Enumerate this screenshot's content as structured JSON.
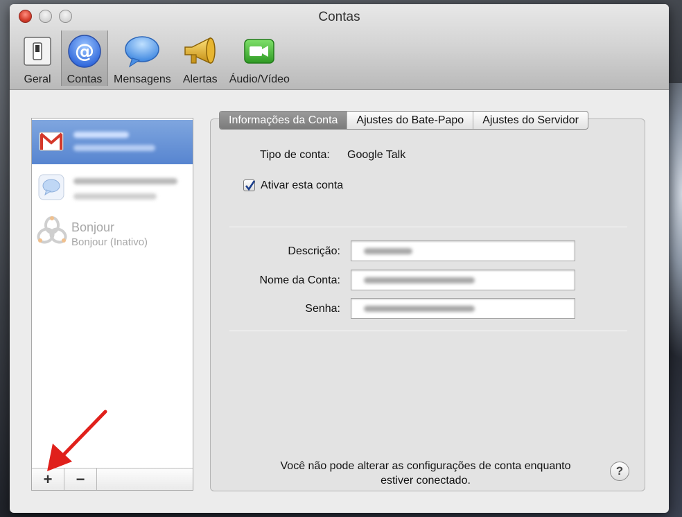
{
  "window": {
    "title": "Contas"
  },
  "toolbar": {
    "items": [
      {
        "label": "Geral",
        "icon": "switch-icon"
      },
      {
        "label": "Contas",
        "icon": "at-sign-icon",
        "selected": true
      },
      {
        "label": "Mensagens",
        "icon": "speech-bubble-icon"
      },
      {
        "label": "Alertas",
        "icon": "megaphone-icon"
      },
      {
        "label": "Áudio/Vídeo",
        "icon": "video-camera-icon"
      }
    ]
  },
  "accounts": {
    "items": [
      {
        "type": "gmail",
        "name": "",
        "status": "",
        "selected": true
      },
      {
        "type": "jabber",
        "name": "",
        "status": ""
      },
      {
        "type": "bonjour",
        "name": "Bonjour",
        "status": "Bonjour (Inativo)"
      }
    ],
    "add_label": "+",
    "remove_label": "−"
  },
  "tabs": [
    {
      "label": "Informações da Conta",
      "active": true
    },
    {
      "label": "Ajustes do Bate-Papo"
    },
    {
      "label": "Ajustes do Servidor"
    }
  ],
  "account_info": {
    "type_label": "Tipo de conta:",
    "type_value": "Google Talk",
    "enable_label": "Ativar esta conta",
    "enable_checked": true,
    "description_label": "Descrição:",
    "description_value": "",
    "account_name_label": "Nome da Conta:",
    "account_name_value": "",
    "password_label": "Senha:",
    "password_value": ""
  },
  "footer": {
    "line1": "Você não pode alterar as configurações de conta enquanto",
    "line2": "estiver conectado.",
    "help_label": "?"
  },
  "colors": {
    "selection": "#5b89d3",
    "arrow": "#e0201b",
    "gmail_red": "#d4382a",
    "facetime_green": "#4cbc3a"
  }
}
